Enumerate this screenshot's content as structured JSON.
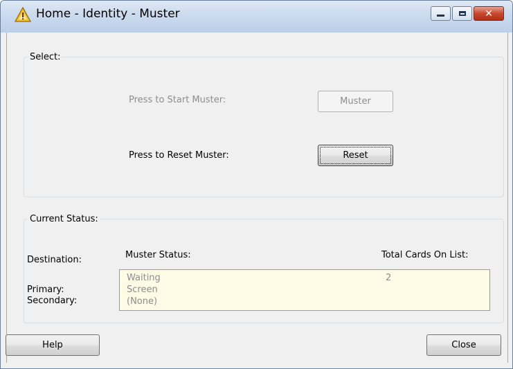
{
  "window": {
    "title": "Home - Identity - Muster",
    "icon": "warning-triangle-icon",
    "buttons": {
      "minimize": "minimize-icon",
      "maximize": "maximize-icon",
      "close": "✕"
    }
  },
  "select_group": {
    "legend": "Select:",
    "start_label": "Press to Start Muster:",
    "start_button": "Muster",
    "reset_label": "Press to Reset Muster:",
    "reset_button": "Reset"
  },
  "status_group": {
    "legend": "Current Status:",
    "headers": {
      "destination": "Destination:",
      "muster_status": "Muster Status:",
      "total_cards": "Total Cards On List:"
    },
    "rows": [
      {
        "destination": "Primary:",
        "status": "Waiting",
        "cards": "2"
      },
      {
        "destination": "Secondary:",
        "status": "Screen",
        "cards": ""
      },
      {
        "destination": "",
        "status": "(None)",
        "cards": ""
      }
    ]
  },
  "footer": {
    "help_button": "Help",
    "close_button": "Close"
  },
  "colors": {
    "status_box_bg": "#fdfbe5",
    "title_gradient": "#cbdaee",
    "close_button": "#c8482f"
  }
}
